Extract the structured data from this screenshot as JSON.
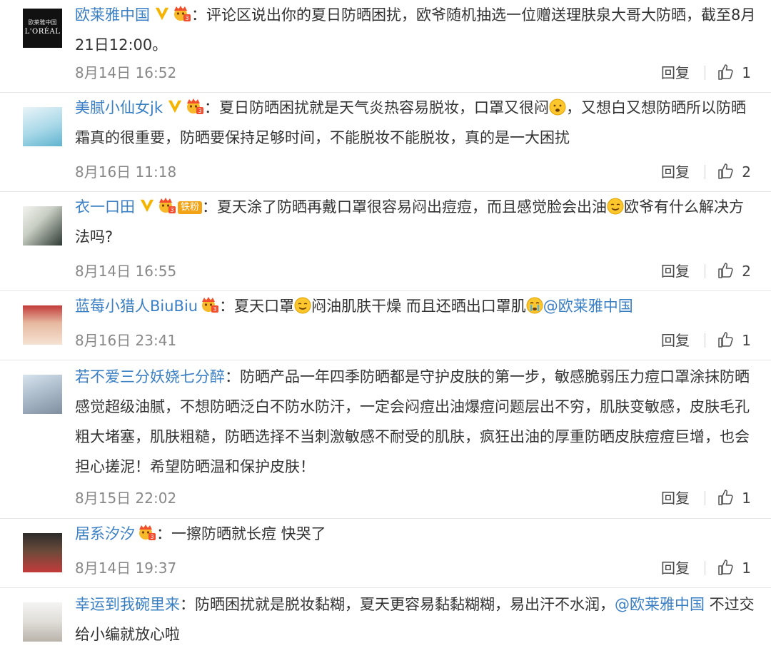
{
  "actions": {
    "reply_label": "回复"
  },
  "comments": [
    {
      "username": "欧莱雅中国",
      "text_1": "：评论区说出你的夏日防晒困扰，欧爷随机抽选一位赠送理肤泉大哥大防晒，截至8月21日12:00。",
      "date": "8月14日 16:52",
      "likes": "1",
      "avatar_logo": {
        "brand": "L'ORÉAL",
        "sub": "欧莱雅中国"
      }
    },
    {
      "username": "美腻小仙女jk",
      "text_1": "：夏日防晒困扰就是天气炎热容易脱妆，口罩又很闷",
      "text_2": "，又想白又想防晒所以防晒霜真的很重要，防晒要保持足够时间，不能脱妆不能脱妆，真的是一大困扰",
      "date": "8月16日 11:18",
      "likes": "2"
    },
    {
      "username": "衣一口田",
      "fan_badge": "铁粉",
      "text_1": "：夏天涂了防晒再戴口罩很容易闷出痘痘，而且感觉脸会出油",
      "text_2": "欧爷有什么解决方法吗?",
      "date": "8月14日 16:55",
      "likes": "2"
    },
    {
      "username": "蓝莓小猎人BiuBiu",
      "text_1": "：夏天口罩",
      "text_2": "闷油肌肤干燥 而且还晒出口罩肌",
      "mention": "@欧莱雅中国",
      "date": "8月16日 23:41",
      "likes": "1"
    },
    {
      "username": "若不爱三分妖娆七分醉",
      "text_1": "：防晒产品一年四季防晒都是守护皮肤的第一步，敏感脆弱压力痘口罩涂抹防晒感觉超级油腻，不想防晒泛白不防水防汗，一定会闷痘出油爆痘问题层出不穷，肌肤变敏感，皮肤毛孔粗大堵塞，肌肤粗糙，防晒选择不当刺激敏感不耐受的肌肤，疯狂出油的厚重防晒皮肤痘痘巨增，也会担心搓泥！希望防晒温和保护皮肤！",
      "date": "8月15日 22:02",
      "likes": "1"
    },
    {
      "username": "居系汐汐",
      "text_1": "：一擦防晒就长痘 快哭了",
      "date": "8月14日 19:37",
      "likes": "1"
    },
    {
      "username": "幸运到我碗里来",
      "text_1": "：防晒困扰就是脱妆黏糊，夏天更容易黏黏糊糊，易出汗不水润，",
      "mention": "@欧莱雅中国",
      "text_2": " 不过交给小编就放心啦",
      "date": "",
      "likes": ""
    }
  ],
  "colors": {
    "username": "#3a7fc4",
    "text": "#333333",
    "date": "#888888",
    "divider": "#e6e6e6",
    "v_badge": "#f5b400",
    "fan_badge": "#f2a316"
  }
}
